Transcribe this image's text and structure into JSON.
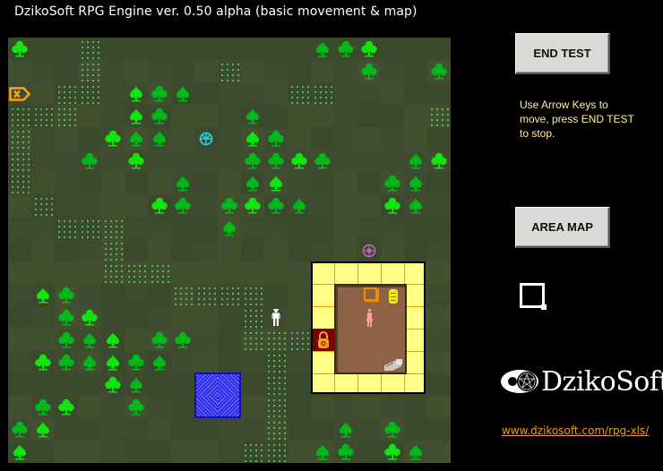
{
  "window": {
    "title": "DzikoSoft RPG Engine ver. 0.50 alpha (basic movement & map)"
  },
  "controls": {
    "end_test_label": "END TEST",
    "area_map_label": "AREA MAP",
    "instructions": "Use Arrow Keys to move, press END TEST to stop."
  },
  "branding": {
    "logo_text": "DzikoSoft",
    "logo_icon": "pentagram-eye-icon",
    "website_link": "www.dzikosoft.com/rpg-xls/"
  },
  "colors": {
    "tree_dark": "#00b81a",
    "tree_light": "#0ee60e",
    "grass_dots": "#55d66b",
    "house_floor": "#ffff88",
    "house_lines": "#f0a000",
    "room_floor": "#8e6244",
    "door_locked": "#7a0000",
    "water": "#2a2ae8",
    "exit_sign": "#f7a01a",
    "flower_cyan": "#22d8f0",
    "flower_pink": "#e070e0",
    "npc": "#f6a0a0",
    "player": "#ffffff",
    "instructions_text": "#ffef9a",
    "link": "#f0a000"
  },
  "map": {
    "columns": 19,
    "rows": 19,
    "grass_tiles": [
      [
        0,
        3
      ],
      [
        1,
        3
      ],
      [
        1,
        9
      ],
      [
        2,
        2
      ],
      [
        2,
        3
      ],
      [
        2,
        12
      ],
      [
        2,
        13
      ],
      [
        3,
        0
      ],
      [
        3,
        1
      ],
      [
        3,
        2
      ],
      [
        3,
        18
      ],
      [
        4,
        0
      ],
      [
        5,
        0
      ],
      [
        6,
        0
      ],
      [
        7,
        1
      ],
      [
        8,
        2
      ],
      [
        8,
        3
      ],
      [
        8,
        4
      ],
      [
        9,
        4
      ],
      [
        10,
        4
      ],
      [
        10,
        5
      ],
      [
        10,
        6
      ],
      [
        11,
        7
      ],
      [
        11,
        8
      ],
      [
        11,
        9
      ],
      [
        11,
        10
      ],
      [
        12,
        10
      ],
      [
        13,
        10
      ],
      [
        13,
        11
      ],
      [
        13,
        12
      ],
      [
        14,
        11
      ],
      [
        15,
        11
      ],
      [
        16,
        11
      ],
      [
        17,
        11
      ],
      [
        18,
        10
      ],
      [
        18,
        11
      ]
    ],
    "trees": [
      {
        "r": 0,
        "c": 0,
        "type": "club"
      },
      {
        "r": 0,
        "c": 13,
        "type": "spade"
      },
      {
        "r": 0,
        "c": 14,
        "type": "club"
      },
      {
        "r": 0,
        "c": 15,
        "type": "club"
      },
      {
        "r": 1,
        "c": 15,
        "type": "club"
      },
      {
        "r": 1,
        "c": 18,
        "type": "club"
      },
      {
        "r": 2,
        "c": 5,
        "type": "spade"
      },
      {
        "r": 2,
        "c": 6,
        "type": "club"
      },
      {
        "r": 2,
        "c": 7,
        "type": "spade"
      },
      {
        "r": 3,
        "c": 5,
        "type": "spade"
      },
      {
        "r": 3,
        "c": 6,
        "type": "club"
      },
      {
        "r": 3,
        "c": 10,
        "type": "spade"
      },
      {
        "r": 4,
        "c": 4,
        "type": "club"
      },
      {
        "r": 4,
        "c": 5,
        "type": "spade"
      },
      {
        "r": 4,
        "c": 6,
        "type": "spade"
      },
      {
        "r": 4,
        "c": 10,
        "type": "spade"
      },
      {
        "r": 4,
        "c": 11,
        "type": "club"
      },
      {
        "r": 5,
        "c": 3,
        "type": "club"
      },
      {
        "r": 5,
        "c": 5,
        "type": "club"
      },
      {
        "r": 5,
        "c": 10,
        "type": "club"
      },
      {
        "r": 5,
        "c": 11,
        "type": "club"
      },
      {
        "r": 5,
        "c": 12,
        "type": "club"
      },
      {
        "r": 5,
        "c": 13,
        "type": "club"
      },
      {
        "r": 5,
        "c": 17,
        "type": "spade"
      },
      {
        "r": 5,
        "c": 18,
        "type": "club"
      },
      {
        "r": 6,
        "c": 7,
        "type": "spade"
      },
      {
        "r": 6,
        "c": 10,
        "type": "spade"
      },
      {
        "r": 6,
        "c": 11,
        "type": "spade"
      },
      {
        "r": 6,
        "c": 16,
        "type": "club"
      },
      {
        "r": 6,
        "c": 17,
        "type": "spade"
      },
      {
        "r": 7,
        "c": 6,
        "type": "club"
      },
      {
        "r": 7,
        "c": 7,
        "type": "club"
      },
      {
        "r": 7,
        "c": 9,
        "type": "club"
      },
      {
        "r": 7,
        "c": 10,
        "type": "club"
      },
      {
        "r": 7,
        "c": 11,
        "type": "club"
      },
      {
        "r": 7,
        "c": 12,
        "type": "spade"
      },
      {
        "r": 7,
        "c": 16,
        "type": "club"
      },
      {
        "r": 7,
        "c": 17,
        "type": "spade"
      },
      {
        "r": 8,
        "c": 9,
        "type": "spade"
      },
      {
        "r": 11,
        "c": 1,
        "type": "spade"
      },
      {
        "r": 11,
        "c": 2,
        "type": "club"
      },
      {
        "r": 12,
        "c": 2,
        "type": "club"
      },
      {
        "r": 12,
        "c": 3,
        "type": "club"
      },
      {
        "r": 13,
        "c": 2,
        "type": "club"
      },
      {
        "r": 13,
        "c": 3,
        "type": "spade"
      },
      {
        "r": 13,
        "c": 4,
        "type": "spade"
      },
      {
        "r": 13,
        "c": 6,
        "type": "club"
      },
      {
        "r": 13,
        "c": 7,
        "type": "club"
      },
      {
        "r": 14,
        "c": 1,
        "type": "club"
      },
      {
        "r": 14,
        "c": 2,
        "type": "club"
      },
      {
        "r": 14,
        "c": 3,
        "type": "spade"
      },
      {
        "r": 14,
        "c": 4,
        "type": "spade"
      },
      {
        "r": 14,
        "c": 5,
        "type": "club"
      },
      {
        "r": 14,
        "c": 6,
        "type": "spade"
      },
      {
        "r": 15,
        "c": 4,
        "type": "club"
      },
      {
        "r": 15,
        "c": 5,
        "type": "spade"
      },
      {
        "r": 16,
        "c": 1,
        "type": "club"
      },
      {
        "r": 16,
        "c": 2,
        "type": "club"
      },
      {
        "r": 16,
        "c": 5,
        "type": "club"
      },
      {
        "r": 17,
        "c": 0,
        "type": "club"
      },
      {
        "r": 17,
        "c": 1,
        "type": "spade"
      },
      {
        "r": 17,
        "c": 14,
        "type": "spade"
      },
      {
        "r": 17,
        "c": 16,
        "type": "club"
      },
      {
        "r": 18,
        "c": 0,
        "type": "spade"
      },
      {
        "r": 18,
        "c": 13,
        "type": "spade"
      },
      {
        "r": 18,
        "c": 14,
        "type": "club"
      },
      {
        "r": 18,
        "c": 16,
        "type": "club"
      },
      {
        "r": 18,
        "c": 17,
        "type": "spade"
      }
    ],
    "objects": [
      {
        "name": "exit-sign-icon",
        "r": 2,
        "c": 0
      },
      {
        "name": "flower-cyan-icon",
        "r": 4,
        "c": 8
      },
      {
        "name": "flower-pink-icon",
        "r": 9,
        "c": 15
      },
      {
        "name": "player-icon",
        "r": 12,
        "c": 11
      }
    ],
    "house": {
      "label": "house",
      "room_items": [
        "chest-icon",
        "barrel-icon",
        "npc-icon",
        "bed-icon"
      ],
      "door": "locked-door-icon"
    },
    "water_label": "pond"
  }
}
